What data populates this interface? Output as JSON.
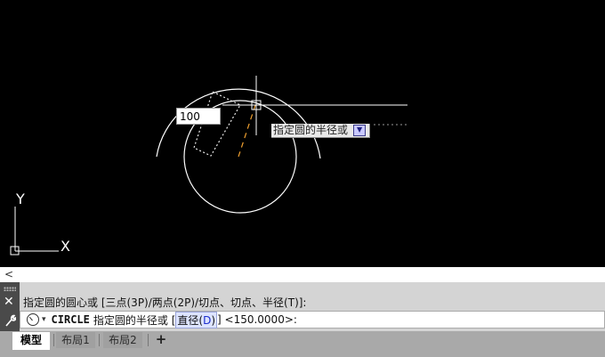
{
  "drawing": {
    "dynamic_input_value": "100",
    "tooltip_text": "指定圆的半径或",
    "tooltip_button_icon": "down-arrow-icon",
    "ucs_y_label": "Y",
    "ucs_x_label": "X"
  },
  "collapse_arrow": "<",
  "command": {
    "history": "指定圆的圆心或 [三点(3P)/两点(2P)/切点、切点、半径(T)]:",
    "prompt_caret": "▾",
    "command_name": "CIRCLE",
    "prompt_text": "指定圆的半径或 [",
    "option_label": "直径(",
    "option_key": "D",
    "option_close": ")",
    "prompt_rest": "] <150.0000>:"
  },
  "tabs": {
    "items": [
      {
        "label": "模型"
      },
      {
        "label": "布局1"
      },
      {
        "label": "布局2"
      }
    ],
    "add_label": "+"
  },
  "colors": {
    "canvas_bg": "#000000",
    "radius_line": "#f0a030",
    "entity": "#ffffff"
  }
}
